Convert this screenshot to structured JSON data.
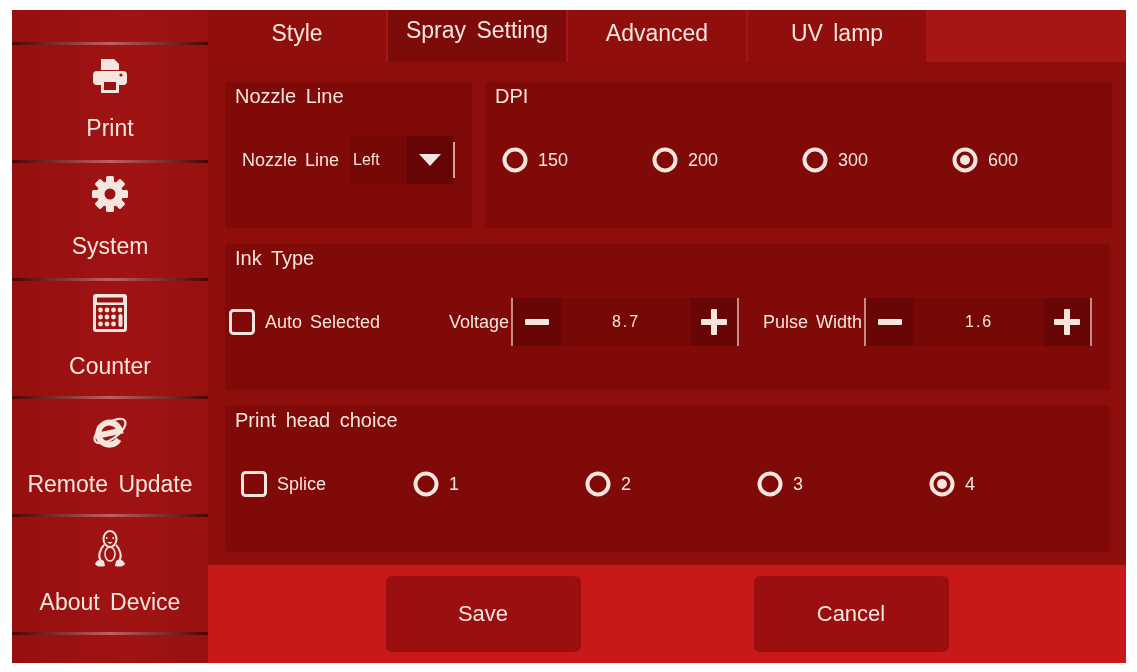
{
  "sidebar": {
    "items": [
      {
        "label": "Print"
      },
      {
        "label": "System"
      },
      {
        "label": "Counter"
      },
      {
        "label": "Remote Update"
      },
      {
        "label": "About Device"
      }
    ]
  },
  "tabs": [
    {
      "label": "Style",
      "selected": false
    },
    {
      "label": "Spray Setting",
      "selected": true
    },
    {
      "label": "Advanced",
      "selected": false
    },
    {
      "label": "UV lamp",
      "selected": false
    }
  ],
  "nozzle_line": {
    "title": "Nozzle Line",
    "label": "Nozzle Line",
    "value": "Left"
  },
  "dpi": {
    "title": "DPI",
    "options": [
      {
        "label": "150",
        "selected": false
      },
      {
        "label": "200",
        "selected": false
      },
      {
        "label": "300",
        "selected": false
      },
      {
        "label": "600",
        "selected": true
      }
    ]
  },
  "ink_type": {
    "title": "Ink Type",
    "auto_selected": {
      "label": "Auto Selected",
      "checked": false
    },
    "steppers": [
      {
        "label": "Voltage",
        "value": "8.7"
      },
      {
        "label": "Pulse Width",
        "value": "1.6"
      }
    ]
  },
  "print_head_choice": {
    "title": "Print head choice",
    "splice": {
      "label": "Splice",
      "checked": false
    },
    "options": [
      {
        "label": "1",
        "selected": false
      },
      {
        "label": "2",
        "selected": false
      },
      {
        "label": "3",
        "selected": false
      },
      {
        "label": "4",
        "selected": true
      }
    ]
  },
  "buttons": [
    {
      "label": "Save"
    },
    {
      "label": "Cancel"
    }
  ]
}
